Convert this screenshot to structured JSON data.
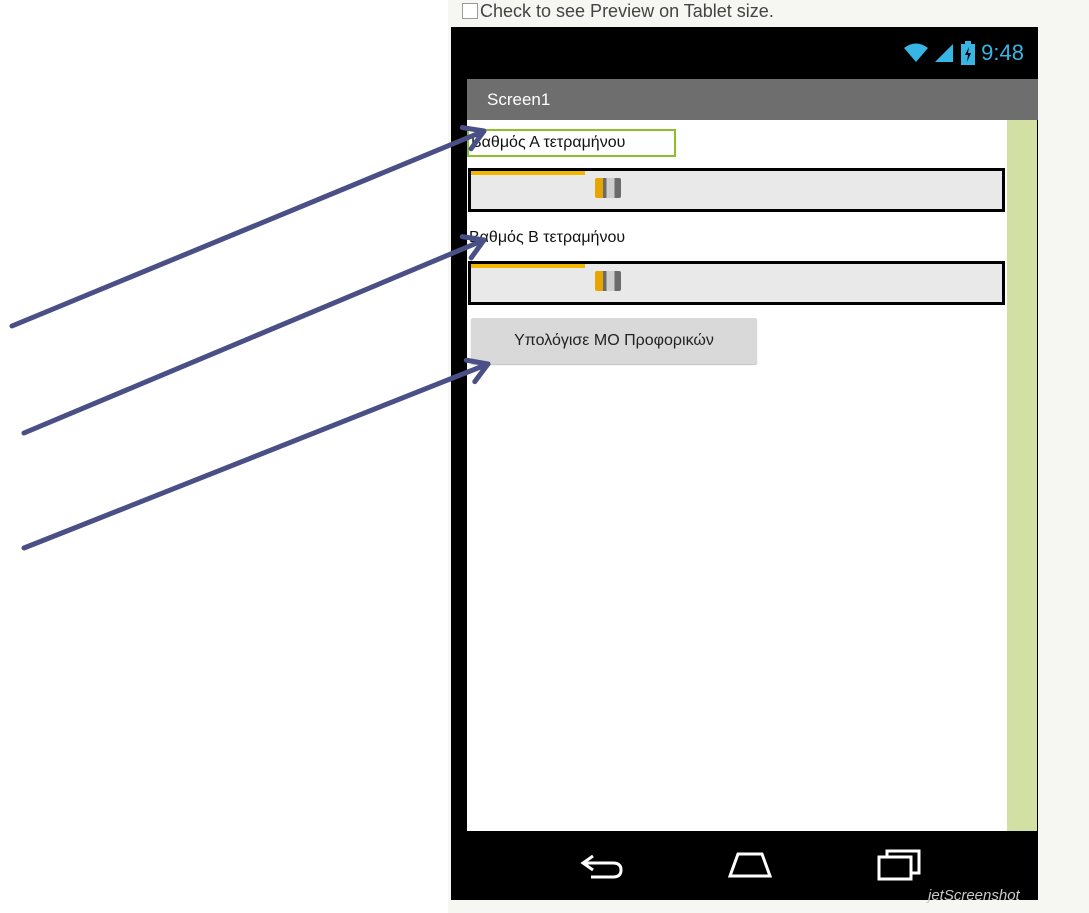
{
  "preview_checkbox": {
    "label": "Check to see Preview on Tablet size.",
    "checked": false
  },
  "status_bar": {
    "time": "9:48",
    "icons": [
      "wifi-icon",
      "signal-icon",
      "battery-charging-icon"
    ]
  },
  "screen": {
    "title": "Screen1"
  },
  "components": {
    "label_a": {
      "text": "Βαθμός Α τετραμήνου"
    },
    "slider_a": {
      "value_fraction": 0.25
    },
    "label_b": {
      "text": "Βαθμός Β τετραμήνου"
    },
    "slider_b": {
      "value_fraction": 0.25
    },
    "calc_button": {
      "label": "Υπολόγισε ΜΟ Προφορικών"
    }
  },
  "nav_bar": {
    "icons": [
      "back-icon",
      "home-icon",
      "recent-apps-icon"
    ]
  },
  "watermark": {
    "text": "jetScreenshot"
  },
  "colors": {
    "accent_arrow": "#4a4f86",
    "titlebar": "#6e6e6e",
    "status_icons": "#37b5e5",
    "slider_fill": "#f2b800",
    "selection_border": "#8dbf2a",
    "side_strip": "#d2e0a4"
  }
}
